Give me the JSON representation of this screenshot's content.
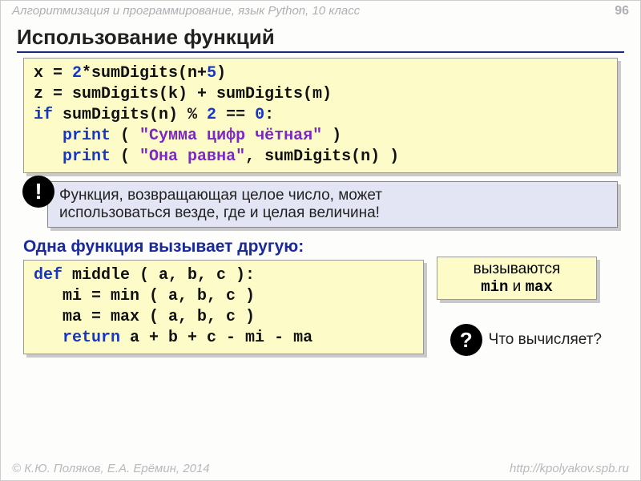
{
  "header": {
    "course": "Алгоритмизация и программирование, язык Python, 10 класс",
    "page": "96"
  },
  "title": "Использование функций",
  "code1": {
    "l1a": "x = ",
    "l1b": "2",
    "l1c": "*sumDigits(n+",
    "l1d": "5",
    "l1e": ")",
    "l2": "z = sumDigits(k) + sumDigits(m)",
    "l3a": "if",
    "l3b": " sumDigits(n) % ",
    "l3c": "2",
    "l3d": " == ",
    "l3e": "0",
    "l3f": ":",
    "l4a": "   ",
    "l4b": "print",
    "l4c": " ( ",
    "l4d": "\"Сумма цифр чётная\"",
    "l4e": " )",
    "l5a": "   ",
    "l5b": "print",
    "l5c": " ( ",
    "l5d": "\"Она равна\"",
    "l5e": ", sumDigits(n) )"
  },
  "note": {
    "bang": "!",
    "line1": "Функция, возвращающая целое число, может",
    "line2": "использоваться везде, где и целая величина!"
  },
  "subhead": "Одна функция вызывает другую:",
  "code2": {
    "l1a": "def",
    "l1b": " middle ( a, b, c ):",
    "l2": "   mi = min ( a, b, c )",
    "l3": "   ma = max ( a, b, c )",
    "l4a": "   ",
    "l4b": "return",
    "l4c": " a + b + c - mi - ma"
  },
  "callout": {
    "line1": "вызываются",
    "min": "min",
    "and": " и ",
    "max": "max"
  },
  "question": {
    "mark": "?",
    "text": "Что вычисляет?"
  },
  "footer": {
    "left": "© К.Ю. Поляков, Е.А. Ерёмин, 2014",
    "right": "http://kpolyakov.spb.ru"
  }
}
